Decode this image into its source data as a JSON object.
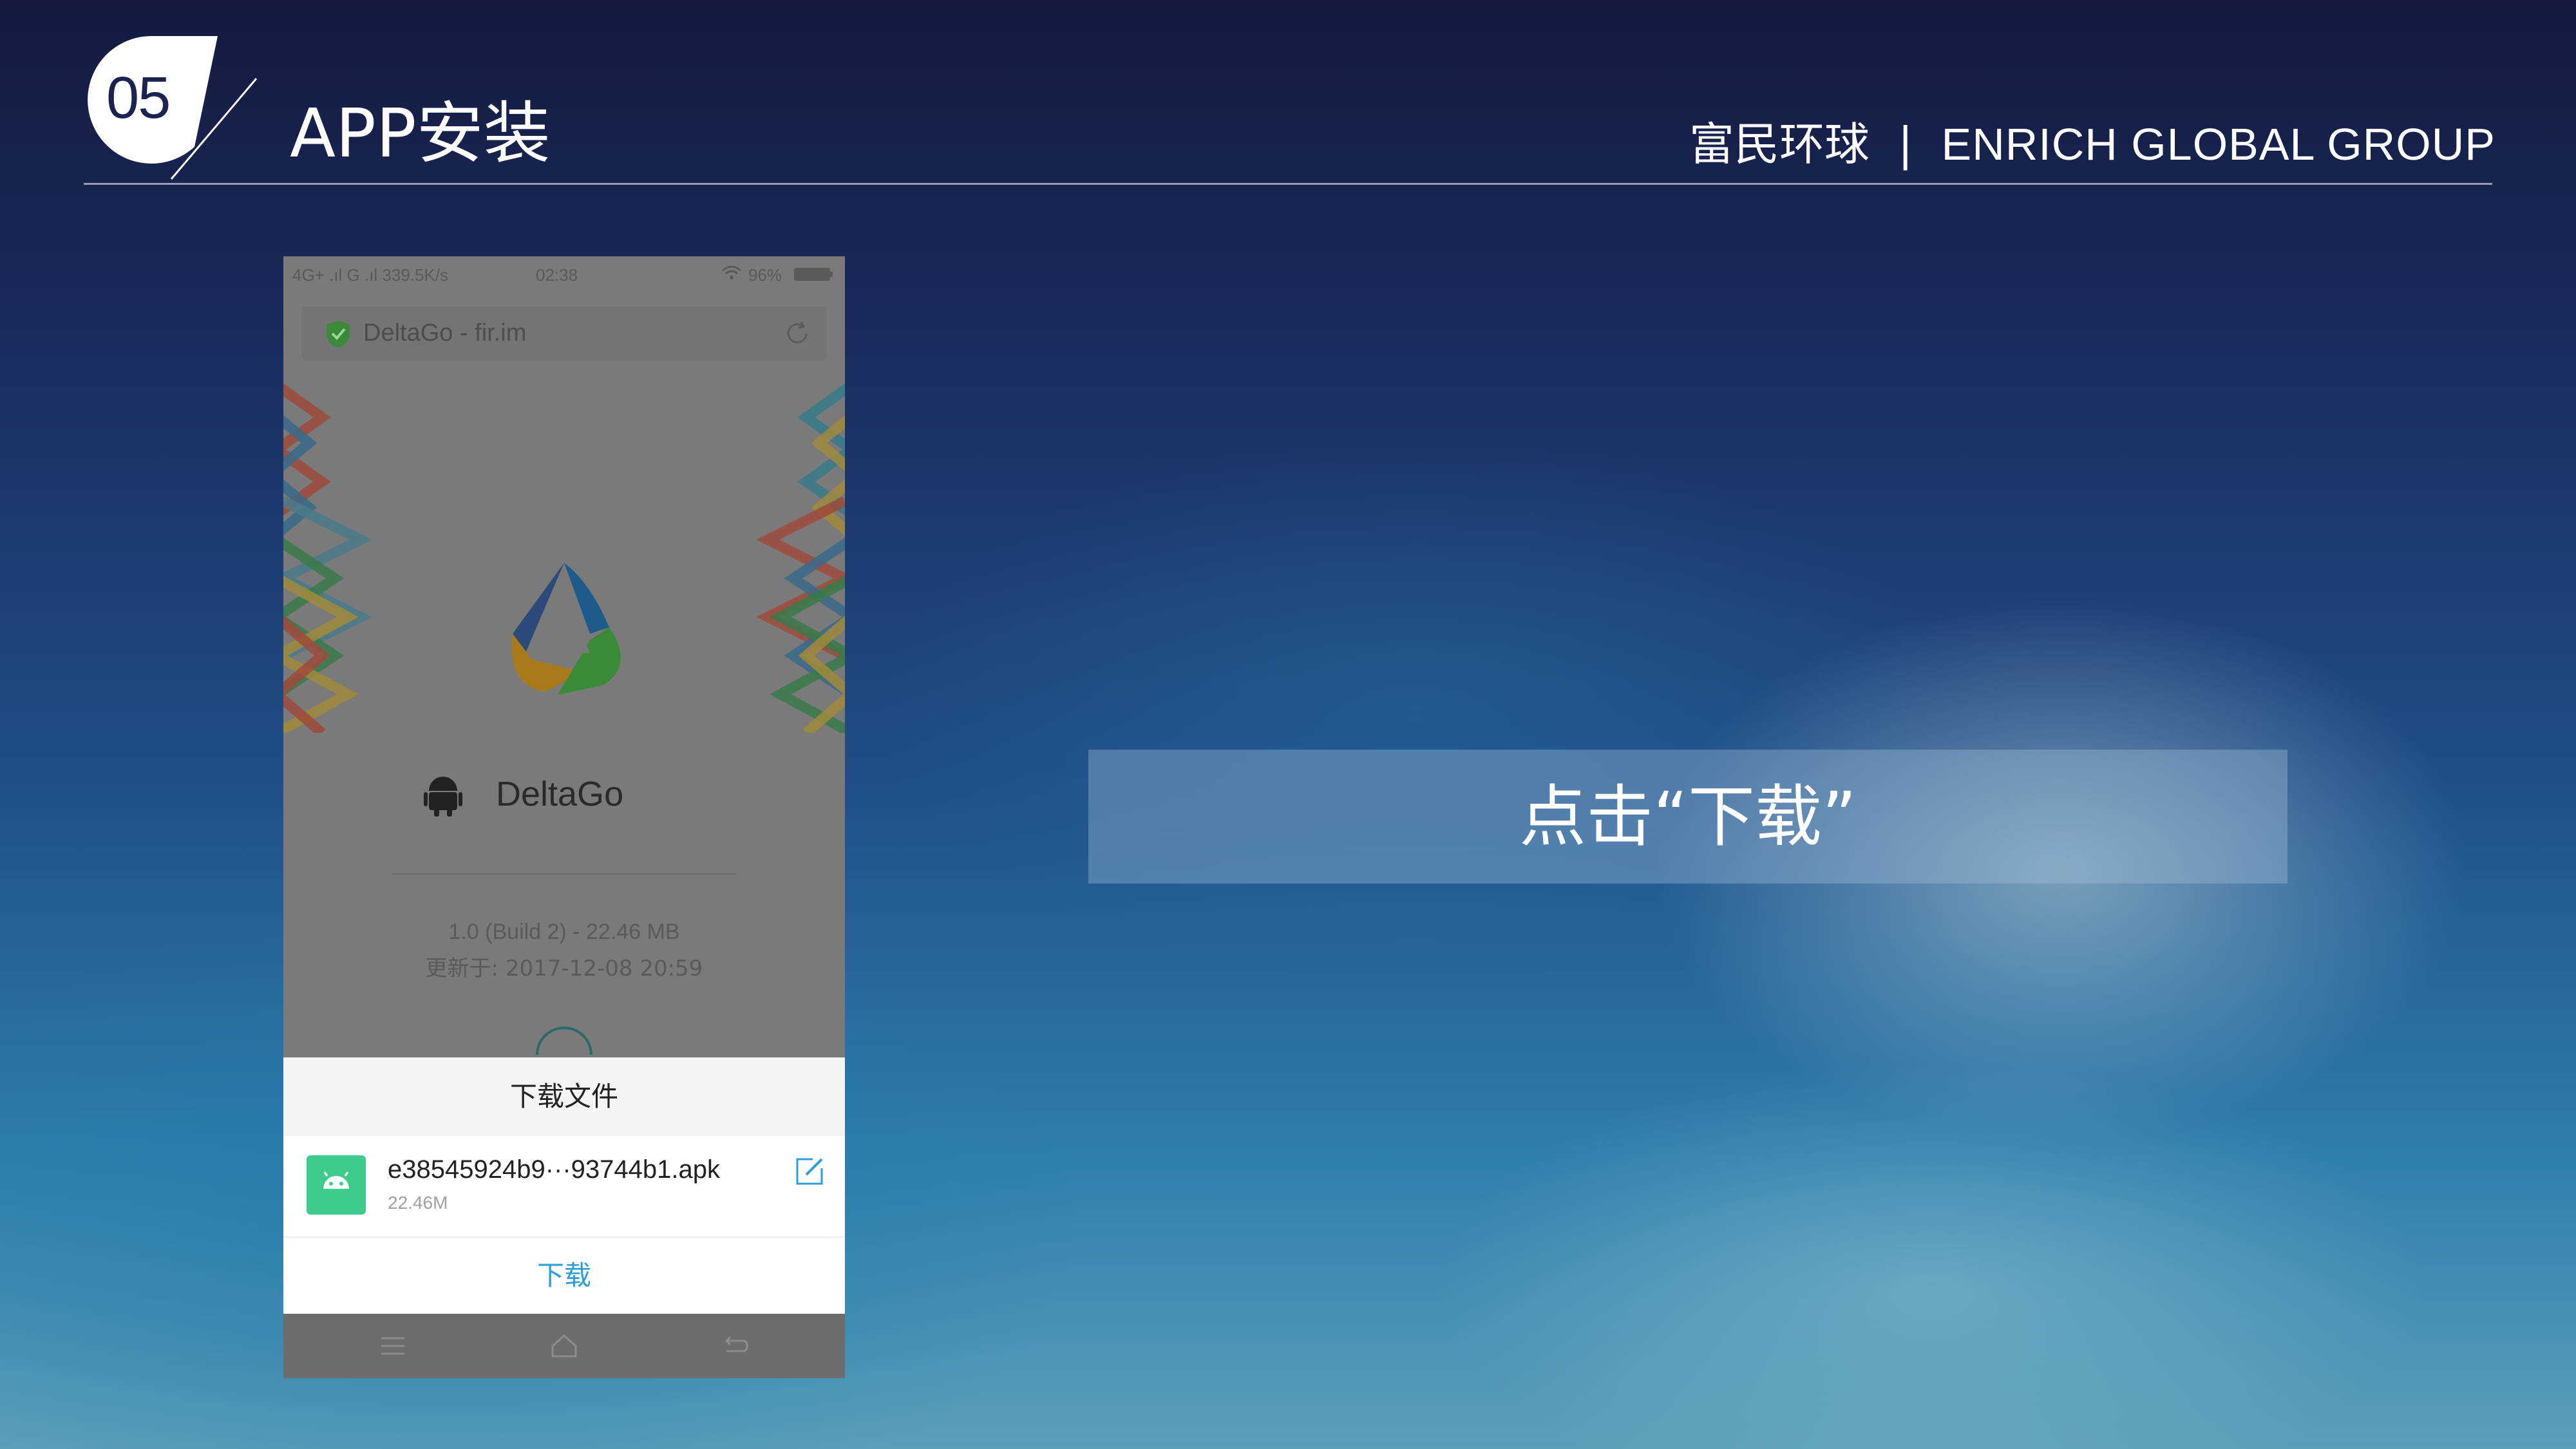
{
  "slide": {
    "number": "05",
    "title": "APP安装",
    "brand_cn": "富民环球",
    "brand_separator": "|",
    "brand_en": "ENRICH GLOBAL GROUP",
    "instruction": "点击“下载”"
  },
  "phone": {
    "status_bar": {
      "left": "4G+ .ıl  G .ıl  339.5K/s",
      "time": "02:38",
      "battery": "96%"
    },
    "browser": {
      "url_title": "DeltaGo - fir.im"
    },
    "app": {
      "name": "DeltaGo",
      "build": "1.0 (Build 2) - 22.46 MB",
      "updated": "更新于: 2017-12-08 20:59"
    },
    "download_sheet": {
      "title": "下载文件",
      "file_name": "e38545924b9···93744b1.apk",
      "file_size": "22.46M",
      "download_label": "下载"
    }
  },
  "colors": {
    "accent_blue": "#2c9fd6",
    "android_green": "#3ecb8c"
  },
  "icons": [
    "shield-icon",
    "refresh-icon",
    "android-icon",
    "edit-icon",
    "menu-icon",
    "home-icon",
    "back-icon"
  ]
}
